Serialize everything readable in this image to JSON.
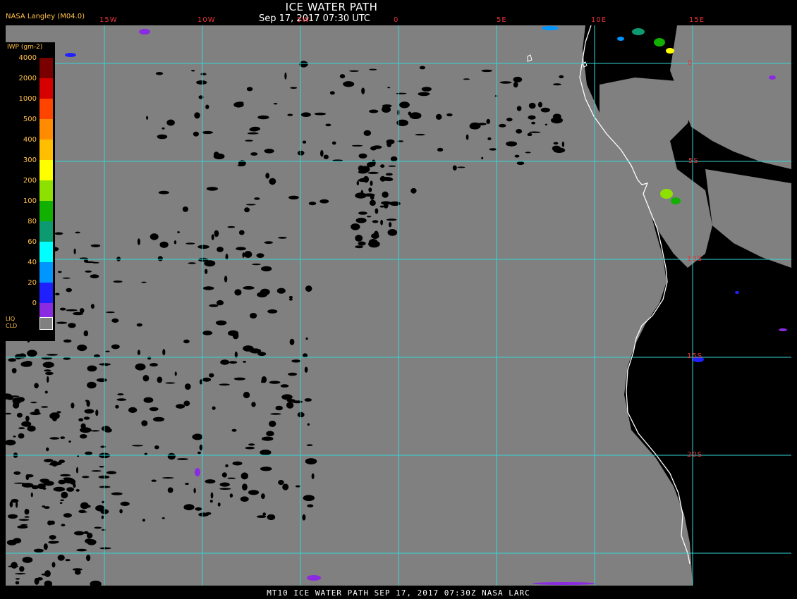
{
  "header": {
    "title": "ICE WATER PATH",
    "subtitle": "Sep 17, 2017 07:30 UTC",
    "producer": "NASA Langley (M04.0)"
  },
  "footer": {
    "text": "MT10  ICE WATER PATH  SEP 17, 2017 07:30Z  NASA LARC"
  },
  "map": {
    "background_color": "#000000",
    "cloud_color": "#808080",
    "grid_color": "#35d6d6",
    "coast_color": "#ffffff",
    "label_color": "#e8323a",
    "lon_labels": [
      "15W",
      "10W",
      "5W",
      "0",
      "5E",
      "10E",
      "15E"
    ],
    "lat_labels": [
      "0",
      "5S",
      "10S",
      "15S",
      "20S"
    ]
  },
  "legend": {
    "title": "IWP (gm-2)",
    "liq_label_top": "LIQ",
    "liq_label_bottom": "CLD",
    "levels": [
      {
        "value": "4000",
        "color": "#7a0000"
      },
      {
        "value": "2000",
        "color": "#d60000"
      },
      {
        "value": "1000",
        "color": "#ff4400"
      },
      {
        "value": "500",
        "color": "#ff8c00"
      },
      {
        "value": "400",
        "color": "#ffbf00"
      },
      {
        "value": "300",
        "color": "#ffff00"
      },
      {
        "value": "200",
        "color": "#8ee000"
      },
      {
        "value": "100",
        "color": "#12b000"
      },
      {
        "value": "80",
        "color": "#0d9a70"
      },
      {
        "value": "60",
        "color": "#00ffff"
      },
      {
        "value": "40",
        "color": "#0096ff"
      },
      {
        "value": "20",
        "color": "#2020ff"
      },
      {
        "value": "0",
        "color": "#8a2be2"
      }
    ]
  }
}
